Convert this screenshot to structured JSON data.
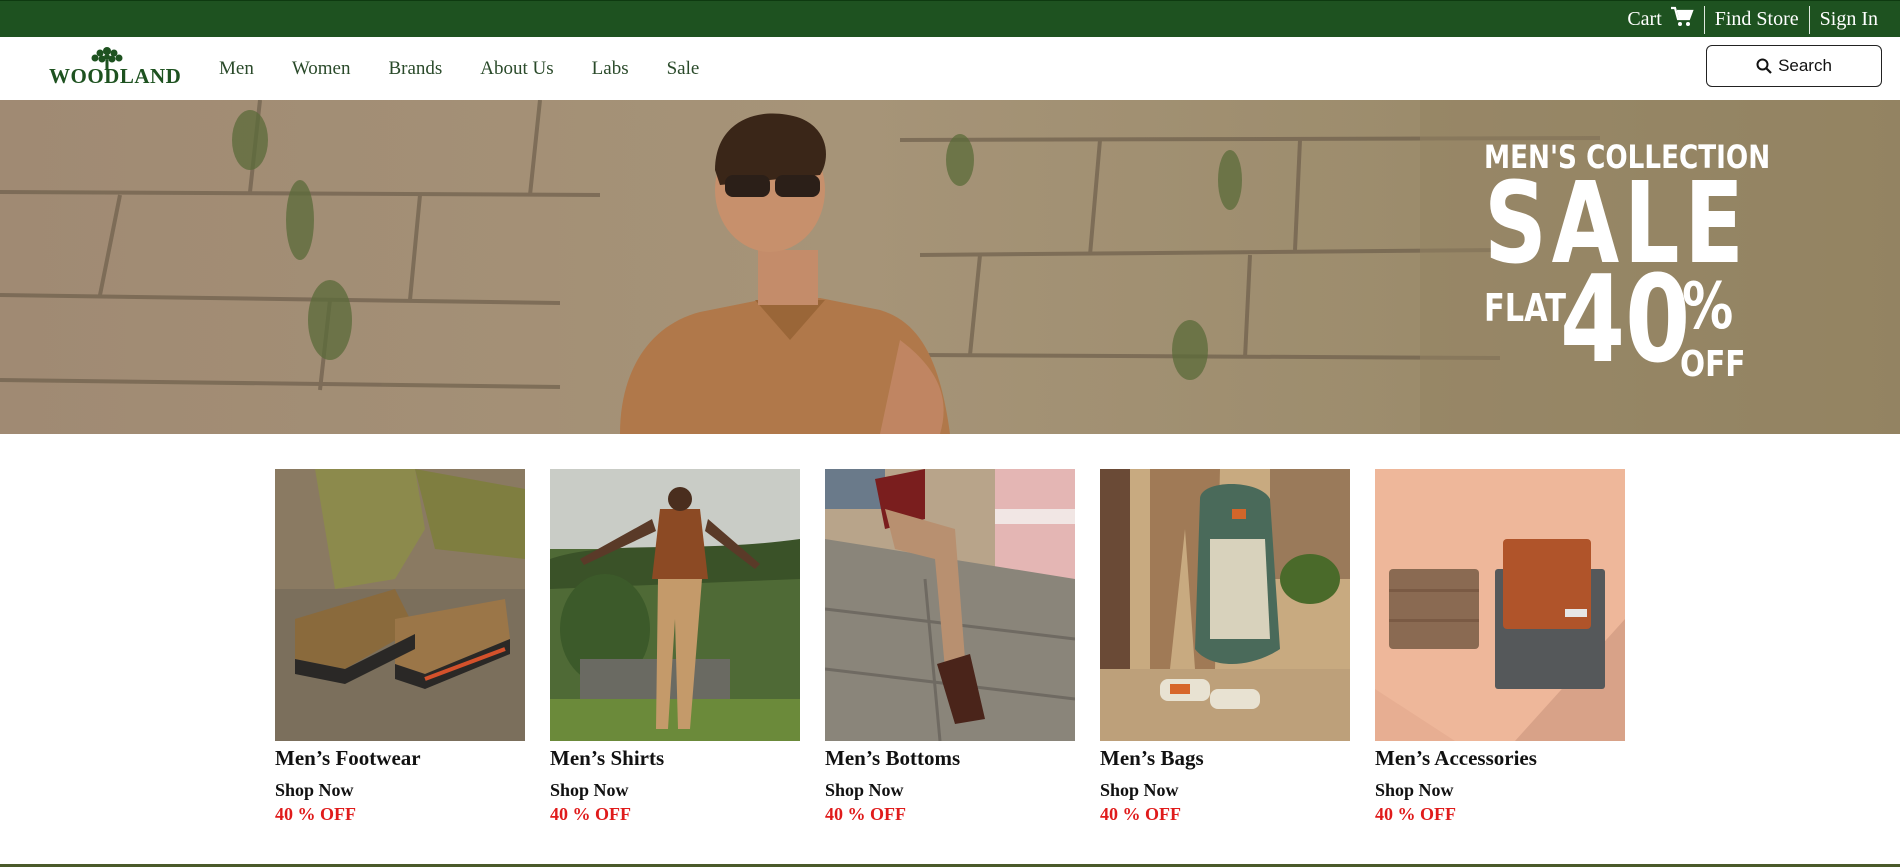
{
  "topbar": {
    "cart_label": "Cart",
    "find_store_label": "Find Store",
    "sign_in_label": "Sign In"
  },
  "nav": {
    "logo_text": "WOODLAND",
    "menu": [
      "Men",
      "Women",
      "Brands",
      "About Us",
      "Labs",
      "Sale"
    ],
    "search_label": "Search"
  },
  "hero": {
    "line1": "MEN'S COLLECTION",
    "line2": "SALE",
    "flat": "FLAT",
    "percent_value": "40",
    "percent_sign": "%",
    "off": "OFF"
  },
  "categories": [
    {
      "title": "Men’s Footwear",
      "shop": "Shop Now",
      "discount": "40 % OFF"
    },
    {
      "title": "Men’s Shirts",
      "shop": "Shop Now",
      "discount": "40 % OFF"
    },
    {
      "title": "Men’s Bottoms",
      "shop": "Shop Now",
      "discount": "40 % OFF"
    },
    {
      "title": "Men’s Bags",
      "shop": "Shop Now",
      "discount": "40 % OFF"
    },
    {
      "title": "Men’s Accessories",
      "shop": "Shop Now",
      "discount": "40 % OFF"
    }
  ],
  "colors": {
    "brand_green": "#1e5220",
    "discount_red": "#e01b1b"
  }
}
